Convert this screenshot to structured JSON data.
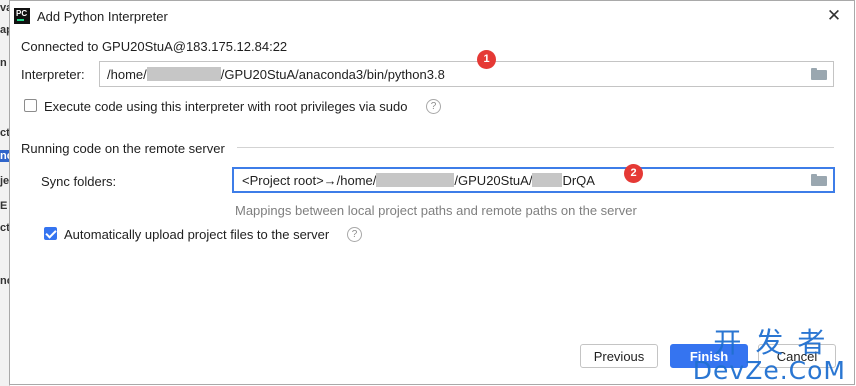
{
  "background_ide": {
    "fragments": [
      "va",
      "ap",
      "n",
      "ct",
      "nc",
      "je",
      "E",
      "ct",
      "nc"
    ]
  },
  "dialog": {
    "title": "Add Python Interpreter",
    "app_icon_text": "PC",
    "close_symbol": "✕",
    "connected_text": "Connected to GPU20StuA@183.175.12.84:22",
    "interpreter": {
      "label": "Interpreter:",
      "value_prefix": "/home/",
      "value_suffix": "/GPU20StuA/anaconda3/bin/python3.8"
    },
    "sudo_checkbox": {
      "label": "Execute code using this interpreter with root privileges via sudo",
      "checked": false
    },
    "section_title": "Running code on the remote server",
    "sync_folders": {
      "label": "Sync folders:",
      "value_prefix": "<Project root>→/home/",
      "value_mid": "/GPU20StuA/",
      "value_suffix": "DrQA",
      "hint": "Mappings between local project paths and remote paths on the server"
    },
    "auto_upload_checkbox": {
      "label": "Automatically upload project files to the server",
      "checked": true
    },
    "buttons": {
      "previous": "Previous",
      "finish": "Finish",
      "cancel": "Cancel"
    },
    "help_symbol": "?"
  },
  "annotations": {
    "badge_1": "1",
    "badge_2": "2"
  },
  "watermark": {
    "cn": "开发者",
    "en": "DevZe.CoM"
  },
  "colors": {
    "accent": "#3574f0",
    "focus_border": "#3d7de8",
    "badge": "#e53935",
    "hint_text": "#7f7f7f",
    "watermark": "#1f6fd0"
  }
}
